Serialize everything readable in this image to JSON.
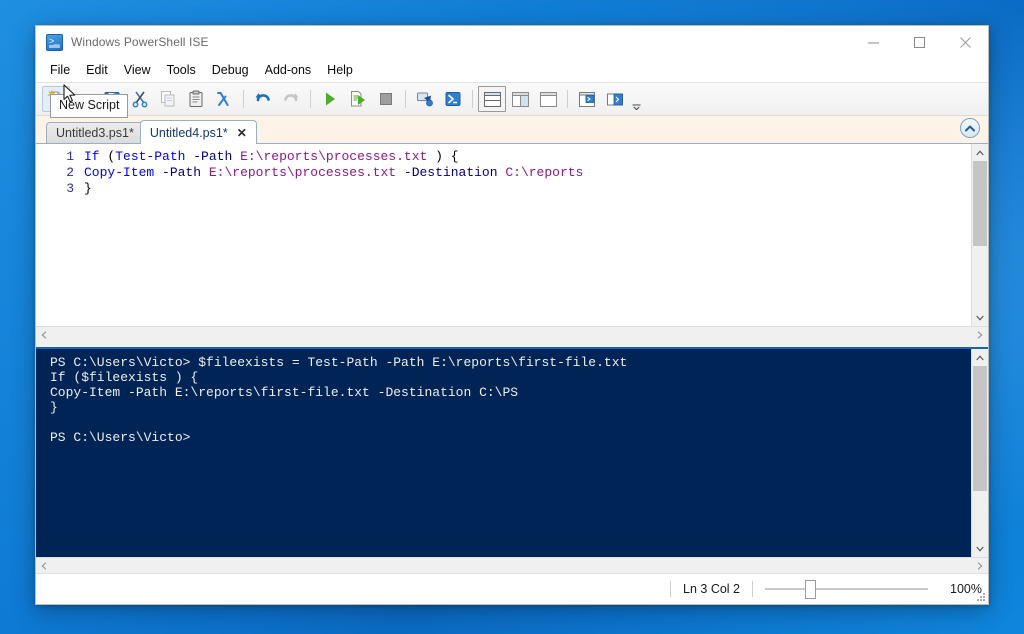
{
  "window": {
    "title": "Windows PowerShell ISE",
    "app_icon": "powershell-icon",
    "controls": {
      "minimize": "minimize-icon",
      "maximize": "maximize-icon",
      "close": "close-icon"
    }
  },
  "menubar": {
    "items": [
      {
        "label": "File"
      },
      {
        "label": "Edit"
      },
      {
        "label": "View"
      },
      {
        "label": "Tools"
      },
      {
        "label": "Debug"
      },
      {
        "label": "Add-ons"
      },
      {
        "label": "Help"
      }
    ]
  },
  "toolbar": {
    "buttons": [
      {
        "name": "new-script-button",
        "icon": "new-document-icon",
        "state": "pressed"
      },
      {
        "name": "open-script-button",
        "icon": "open-folder-icon",
        "state": "normal"
      },
      {
        "name": "save-button",
        "icon": "floppy-disk-icon",
        "state": "normal"
      },
      {
        "name": "cut-button",
        "icon": "scissors-icon",
        "state": "normal"
      },
      {
        "name": "copy-button",
        "icon": "copy-pages-icon",
        "state": "disabled"
      },
      {
        "name": "paste-button",
        "icon": "clipboard-icon",
        "state": "normal"
      },
      {
        "name": "clear-console-button",
        "icon": "lambda-icon",
        "state": "normal"
      },
      {
        "name": "undo-button",
        "icon": "undo-arrow-icon",
        "state": "normal"
      },
      {
        "name": "redo-button",
        "icon": "redo-arrow-icon",
        "state": "disabled"
      },
      {
        "name": "run-script-button",
        "icon": "green-play-icon",
        "state": "normal"
      },
      {
        "name": "run-selection-button",
        "icon": "document-play-icon",
        "state": "normal"
      },
      {
        "name": "stop-operation-button",
        "icon": "stop-square-icon",
        "state": "disabled"
      },
      {
        "name": "new-remote-tab-button",
        "icon": "remote-connect-icon",
        "state": "normal"
      },
      {
        "name": "start-powershell-button",
        "icon": "powershell-console-icon",
        "state": "normal"
      },
      {
        "name": "layout-stacked-button",
        "icon": "layout-stacked-icon",
        "state": "boxed"
      },
      {
        "name": "layout-side-by-side-button",
        "icon": "layout-side-icon",
        "state": "normal"
      },
      {
        "name": "layout-maximize-script-button",
        "icon": "layout-full-icon",
        "state": "normal"
      },
      {
        "name": "show-script-pane-button",
        "icon": "script-pane-top-icon",
        "state": "normal"
      },
      {
        "name": "show-command-pane-button",
        "icon": "command-pane-icon",
        "state": "normal"
      }
    ],
    "overflow_label": "toolbar-overflow"
  },
  "tooltip": {
    "text": "New Script",
    "visible": true
  },
  "tabs": [
    {
      "label": "Untitled3.ps1",
      "modified_marker": "*",
      "active": false
    },
    {
      "label": "Untitled4.ps1",
      "modified_marker": "*",
      "active": true,
      "close_glyph": "✕"
    }
  ],
  "collapse_button": {
    "icon": "chevron-up-circle-icon"
  },
  "editor": {
    "lines": [
      {
        "number": "1",
        "tokens": [
          {
            "t": "If ",
            "c": "kw"
          },
          {
            "t": "(",
            "c": "punct"
          },
          {
            "t": "Test-Path",
            "c": "cmd"
          },
          {
            "t": " ",
            "c": "plain"
          },
          {
            "t": "-Path",
            "c": "param"
          },
          {
            "t": " ",
            "c": "plain"
          },
          {
            "t": "E:\\reports\\processes.txt",
            "c": "str"
          },
          {
            "t": " ) {",
            "c": "punct"
          }
        ]
      },
      {
        "number": "2",
        "tokens": [
          {
            "t": "Copy-Item",
            "c": "cmd"
          },
          {
            "t": " ",
            "c": "plain"
          },
          {
            "t": "-Path",
            "c": "param"
          },
          {
            "t": " ",
            "c": "plain"
          },
          {
            "t": "E:\\reports\\processes.txt",
            "c": "str"
          },
          {
            "t": " ",
            "c": "plain"
          },
          {
            "t": "-Destination",
            "c": "param"
          },
          {
            "t": " ",
            "c": "plain"
          },
          {
            "t": "C:\\reports",
            "c": "str"
          }
        ]
      },
      {
        "number": "3",
        "tokens": [
          {
            "t": "}",
            "c": "punct"
          }
        ]
      }
    ]
  },
  "console": {
    "text": "PS C:\\Users\\Victo> $fileexists = Test-Path -Path E:\\reports\\first-file.txt\nIf ($fileexists ) {\nCopy-Item -Path E:\\reports\\first-file.txt -Destination C:\\PS\n}\n\nPS C:\\Users\\Victo>"
  },
  "statusbar": {
    "position": "Ln 3  Col 2",
    "zoom_percent": "100%",
    "zoom_value": 100,
    "resize_grip": "resize-grip-icon"
  },
  "colors": {
    "console_bg": "#012456",
    "desktop_blue": "#0e7ad4",
    "tabstrip_bg": "#fdf3e6",
    "keyword_blue": "#0000ff",
    "string_magenta": "#8b1a8b",
    "param_navy": "#000080",
    "linenumber_blue": "#2e2e9e"
  }
}
